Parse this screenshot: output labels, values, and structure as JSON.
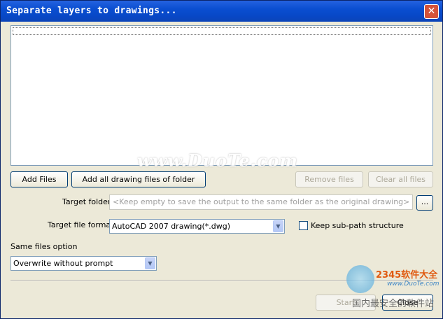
{
  "window": {
    "title": "Separate layers to drawings...",
    "close_glyph": "✕"
  },
  "file_list": {
    "items": []
  },
  "buttons": {
    "add_files": "Add Files",
    "add_all": "Add all drawing files of folder",
    "remove_files": "Remove files",
    "clear_all": "Clear all files",
    "browse": "...",
    "start": "Start",
    "close": "Close"
  },
  "target_folder": {
    "label": "Target folder",
    "placeholder": "<Keep empty to save the output to the same folder as the original drawing>"
  },
  "target_format": {
    "label": "Target file format",
    "value": "AutoCAD 2007 drawing(*.dwg)"
  },
  "keep_subpath": {
    "label": "Keep sub-path structure",
    "checked": false
  },
  "same_files": {
    "label": "Same files option",
    "value": "Overwrite without prompt"
  },
  "watermark": {
    "text": "www.DuoTe.com",
    "logo_text": "2345软件大全",
    "logo_url": "www.DuoTe.com",
    "logo_cn": "国内最安全的软件站"
  },
  "colors": {
    "titlebar": "#0a4ed0",
    "face": "#ece9d8",
    "accent_border": "#003c74"
  }
}
